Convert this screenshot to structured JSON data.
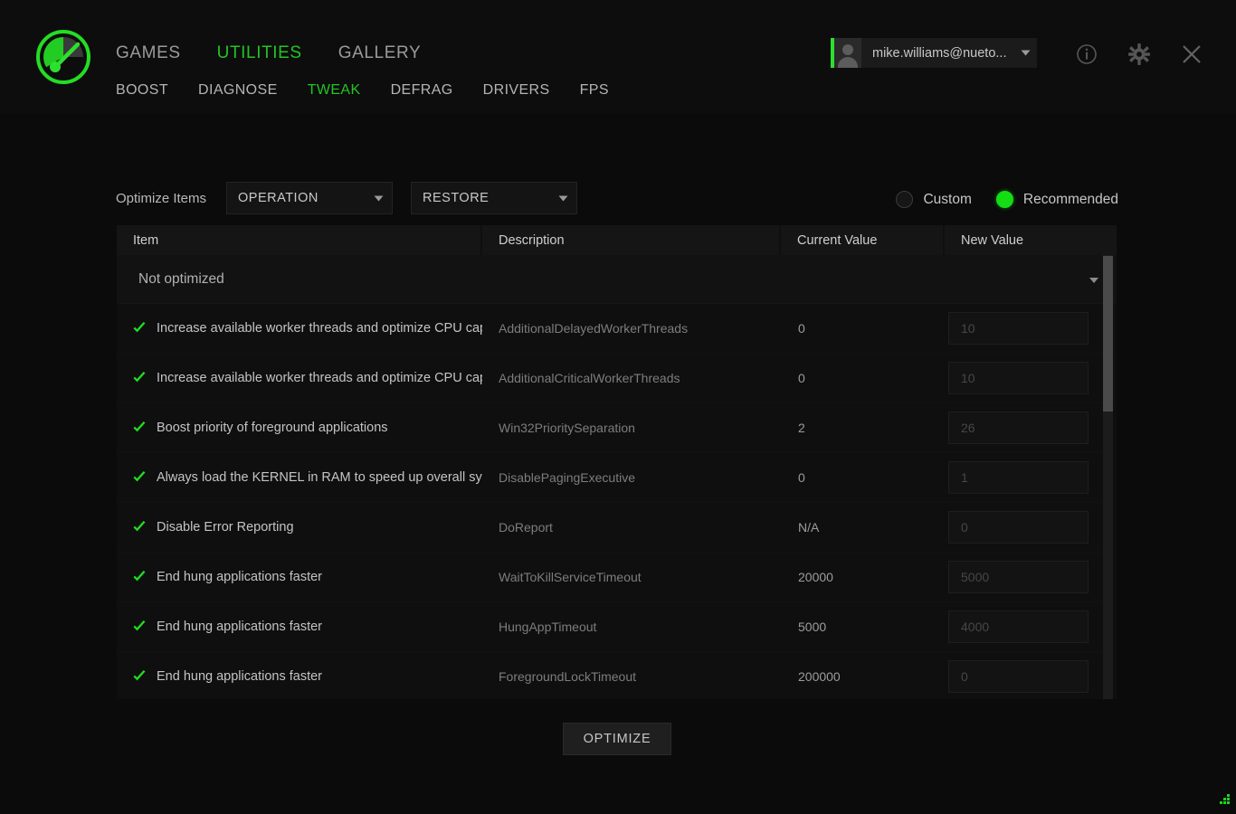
{
  "app": {
    "logo_icon": "gauge-speedometer-icon",
    "accent_color": "#23c423",
    "background_color": "#0b0b0b"
  },
  "header": {
    "main_nav": [
      {
        "label": "GAMES",
        "active": false
      },
      {
        "label": "UTILITIES",
        "active": true
      },
      {
        "label": "GALLERY",
        "active": false
      }
    ],
    "sub_nav": [
      {
        "label": "BOOST",
        "active": false
      },
      {
        "label": "DIAGNOSE",
        "active": false
      },
      {
        "label": "TWEAK",
        "active": true
      },
      {
        "label": "DEFRAG",
        "active": false
      },
      {
        "label": "DRIVERS",
        "active": false
      },
      {
        "label": "FPS",
        "active": false
      }
    ],
    "account": {
      "email": "mike.williams@nueto...",
      "avatar_icon": "user-avatar-icon",
      "caret_icon": "chevron-down-icon"
    },
    "icons": [
      {
        "name": "info-icon",
        "glyph": "i"
      },
      {
        "name": "gear-icon",
        "glyph": "gear"
      },
      {
        "name": "close-icon",
        "glyph": "x"
      }
    ]
  },
  "controls": {
    "label": "Optimize Items",
    "operation_select": {
      "value": "OPERATION",
      "caret_icon": "chevron-down-icon"
    },
    "restore_select": {
      "value": "RESTORE",
      "caret_icon": "chevron-down-icon"
    },
    "modes": [
      {
        "label": "Custom",
        "selected": false
      },
      {
        "label": "Recommended",
        "selected": true
      }
    ]
  },
  "table": {
    "headers": {
      "item": "Item",
      "description": "Description",
      "current_value": "Current Value",
      "new_value": "New Value"
    },
    "group": {
      "label": "Not optimized",
      "caret_icon": "chevron-down-icon"
    },
    "rows": [
      {
        "checked": true,
        "item": "Increase available worker threads and optimize CPU capability",
        "description": "AdditionalDelayedWorkerThreads",
        "current_value": "0",
        "new_value": "10"
      },
      {
        "checked": true,
        "item": "Increase available worker threads and optimize CPU capability",
        "description": "AdditionalCriticalWorkerThreads",
        "current_value": "0",
        "new_value": "10"
      },
      {
        "checked": true,
        "item": "Boost priority of foreground applications",
        "description": "Win32PrioritySeparation",
        "current_value": "2",
        "new_value": "26"
      },
      {
        "checked": true,
        "item": "Always load the KERNEL in RAM to speed up overall system performance",
        "description": "DisablePagingExecutive",
        "current_value": "0",
        "new_value": "1"
      },
      {
        "checked": true,
        "item": "Disable Error Reporting",
        "description": "DoReport",
        "current_value": "N/A",
        "new_value": "0"
      },
      {
        "checked": true,
        "item": "End hung applications faster",
        "description": "WaitToKillServiceTimeout",
        "current_value": "20000",
        "new_value": "5000"
      },
      {
        "checked": true,
        "item": "End hung applications faster",
        "description": "HungAppTimeout",
        "current_value": "5000",
        "new_value": "4000"
      },
      {
        "checked": true,
        "item": "End hung applications faster",
        "description": "ForegroundLockTimeout",
        "current_value": "200000",
        "new_value": "0"
      }
    ],
    "scrollbar": {
      "name": "vertical-scrollbar"
    }
  },
  "footer": {
    "optimize_label": "OPTIMIZE",
    "resize_grip_icon": "resize-grip-icon"
  }
}
